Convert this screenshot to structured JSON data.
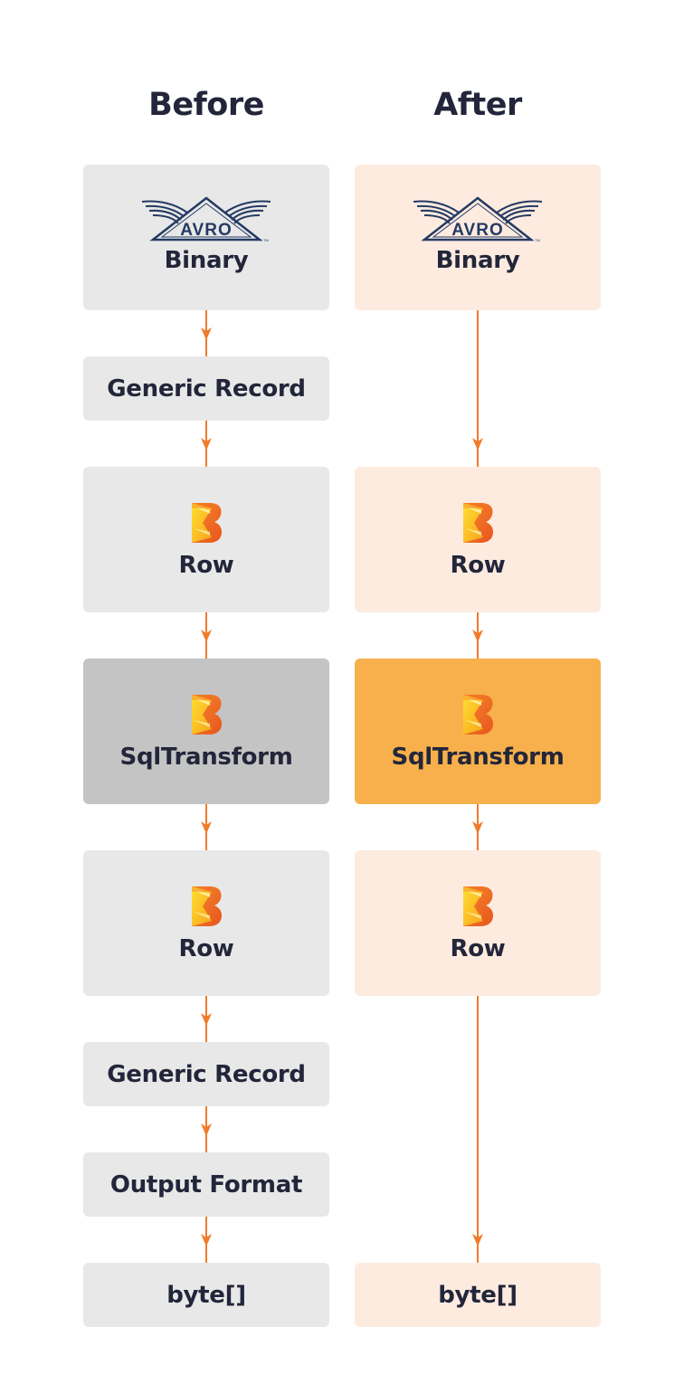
{
  "colors": {
    "arrow": "#f07b2a",
    "before_box": "#e8e8e8",
    "before_highlight": "#c4c4c4",
    "after_box": "#fdebe0",
    "after_highlight": "#f7b04b",
    "text": "#23263a",
    "avro_logo": "#243a63"
  },
  "columns": [
    {
      "heading": "Before",
      "nodes": [
        {
          "label": "Binary",
          "icon": "avro-logo"
        },
        {
          "label": "Generic Record",
          "icon": null
        },
        {
          "label": "Row",
          "icon": "beam-logo"
        },
        {
          "label": "SqlTransform",
          "icon": "beam-logo",
          "highlight": true
        },
        {
          "label": "Row",
          "icon": "beam-logo"
        },
        {
          "label": "Generic Record",
          "icon": null
        },
        {
          "label": "Output Format",
          "icon": null
        },
        {
          "label": "byte[]",
          "icon": null
        }
      ]
    },
    {
      "heading": "After",
      "nodes": [
        {
          "label": "Binary",
          "icon": "avro-logo"
        },
        {
          "label": "Row",
          "icon": "beam-logo"
        },
        {
          "label": "SqlTransform",
          "icon": "beam-logo",
          "highlight": true
        },
        {
          "label": "Row",
          "icon": "beam-logo"
        },
        {
          "label": "byte[]",
          "icon": null
        }
      ]
    }
  ],
  "edges": {
    "before": [
      [
        "Binary",
        "Generic Record"
      ],
      [
        "Generic Record",
        "Row"
      ],
      [
        "Row",
        "SqlTransform"
      ],
      [
        "SqlTransform",
        "Row"
      ],
      [
        "Row",
        "Generic Record"
      ],
      [
        "Generic Record",
        "Output Format"
      ],
      [
        "Output Format",
        "byte[]"
      ]
    ],
    "after": [
      [
        "Binary",
        "Row"
      ],
      [
        "Row",
        "SqlTransform"
      ],
      [
        "SqlTransform",
        "Row"
      ],
      [
        "Row",
        "byte[]"
      ]
    ]
  }
}
